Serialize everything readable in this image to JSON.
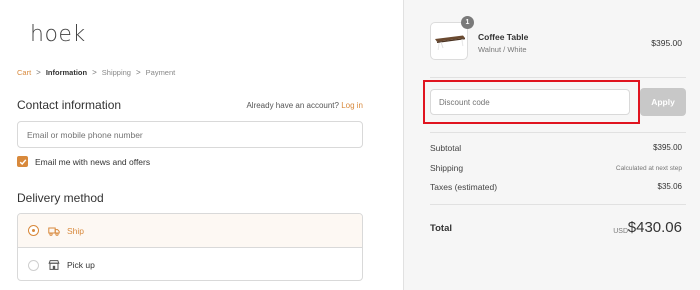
{
  "brand": {
    "logo_text": "hoek"
  },
  "breadcrumb": {
    "items": [
      "Cart",
      "Information",
      "Shipping",
      "Payment"
    ],
    "separator": ">"
  },
  "contact": {
    "title": "Contact information",
    "login_prompt": "Already have an account?",
    "login_link": "Log in",
    "email_placeholder": "Email or mobile phone number",
    "email_value": "",
    "newsletter_label": "Email me with news and offers",
    "newsletter_checked": true
  },
  "delivery": {
    "title": "Delivery method",
    "options": [
      {
        "label": "Ship",
        "icon": "truck-icon",
        "selected": true
      },
      {
        "label": "Pick up",
        "icon": "store-icon",
        "selected": false
      }
    ]
  },
  "summary": {
    "product": {
      "name": "Coffee Table",
      "variant": "Walnut / White",
      "price": "$395.00",
      "quantity": "1"
    },
    "discount": {
      "placeholder": "Discount code",
      "value": "",
      "apply_label": "Apply"
    },
    "subtotal_label": "Subtotal",
    "subtotal_value": "$395.00",
    "shipping_label": "Shipping",
    "shipping_value": "Calculated at next step",
    "taxes_label": "Taxes (estimated)",
    "taxes_value": "$35.06",
    "total_label": "Total",
    "currency": "USD",
    "total_value": "$430.06"
  },
  "colors": {
    "accent": "#d8893c",
    "highlight": "#e0141f",
    "sidebar_bg": "#f6f6f6",
    "apply_disabled": "#c8c8c8"
  }
}
